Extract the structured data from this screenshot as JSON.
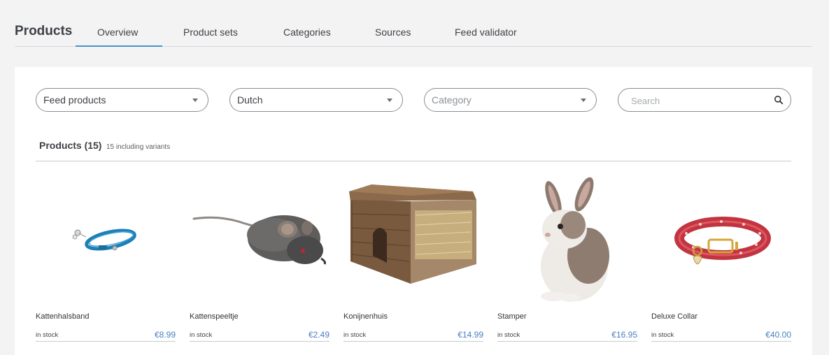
{
  "header": {
    "title": "Products",
    "tabs": [
      {
        "label": "Overview",
        "active": true
      },
      {
        "label": "Product sets"
      },
      {
        "label": "Categories"
      },
      {
        "label": "Sources"
      },
      {
        "label": "Feed validator"
      }
    ]
  },
  "filters": {
    "source": {
      "value": "Feed products"
    },
    "language": {
      "value": "Dutch"
    },
    "category": {
      "placeholder": "Category"
    },
    "search": {
      "placeholder": "Search",
      "icon": "search-icon"
    }
  },
  "summary": {
    "title": "Products (15)",
    "subtitle": "15 including variants"
  },
  "products": [
    {
      "name": "Kattenhalsband",
      "stock": "in stock",
      "price": "€8.99",
      "image": "cat-collar-blue"
    },
    {
      "name": "Kattenspeeltje",
      "stock": "in stock",
      "price": "€2.49",
      "image": "toy-mouse"
    },
    {
      "name": "Konijnenhuis",
      "stock": "in stock",
      "price": "€14.99",
      "image": "wooden-rabbit-house"
    },
    {
      "name": "Stamper",
      "stock": "in stock",
      "price": "€16.95",
      "image": "rabbit"
    },
    {
      "name": "Deluxe Collar",
      "stock": "in stock",
      "price": "€40.00",
      "image": "red-leather-collar"
    }
  ],
  "colors": {
    "accent": "#4a90c8",
    "price": "#4a7fc1"
  }
}
